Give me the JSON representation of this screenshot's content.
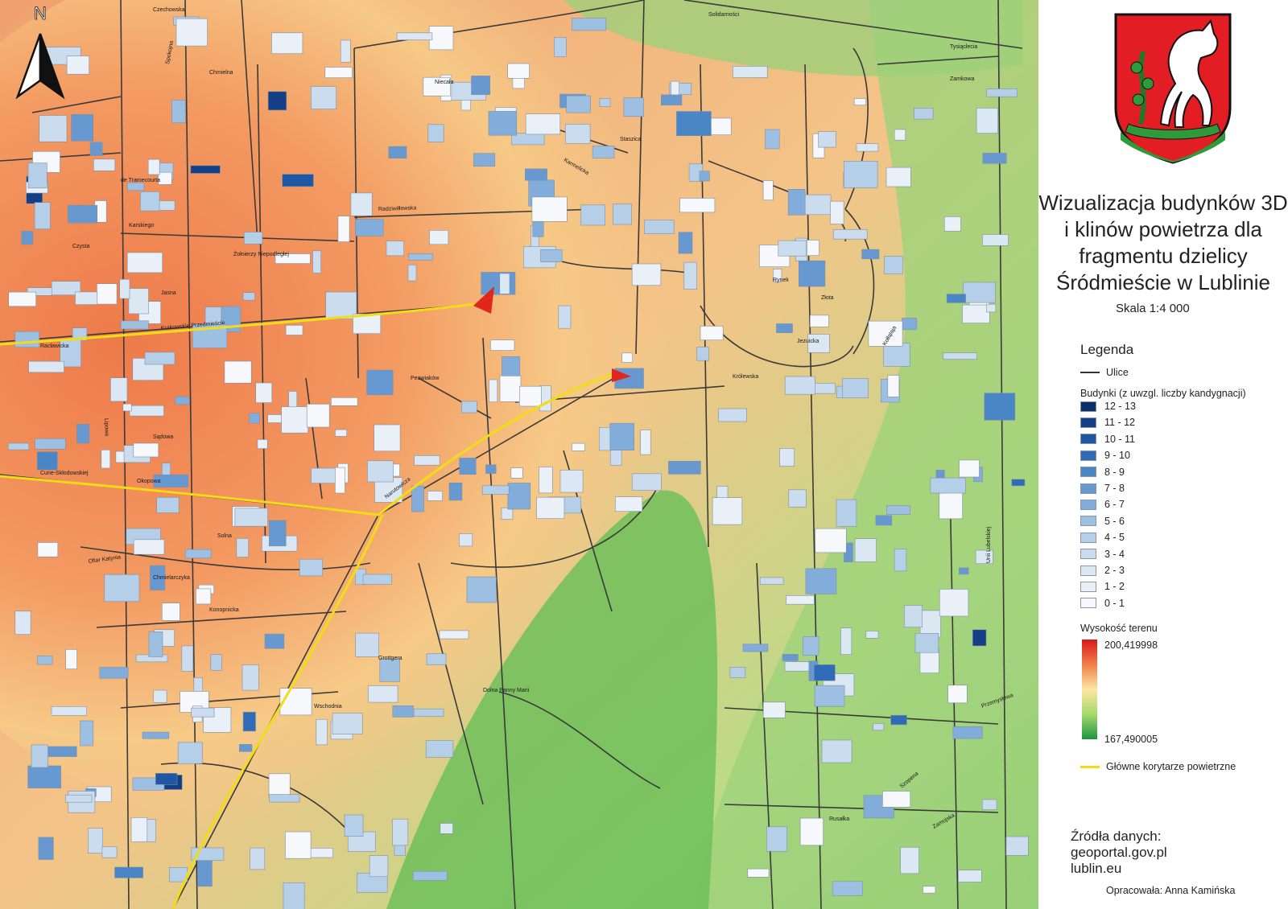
{
  "title_lines": [
    "Wizualizacja budynków 3D",
    "i klinów powietrza dla",
    "fragmentu dzielicy",
    "Śródmieście w Lublinie"
  ],
  "scale": "Skala 1:4 000",
  "north_label": "N",
  "legend": {
    "heading": "Legenda",
    "streets_label": "Ulice",
    "buildings_heading": "Budynki (z uwzgl. liczby kandygnacji)",
    "building_classes": [
      {
        "label": "12 - 13",
        "color": "#0b2f6b"
      },
      {
        "label": "11 - 12",
        "color": "#143f86"
      },
      {
        "label": "10 - 11",
        "color": "#1f57a4"
      },
      {
        "label": "9 - 10",
        "color": "#2f6cb8"
      },
      {
        "label": "8 - 9",
        "color": "#4a85c5"
      },
      {
        "label": "7 - 8",
        "color": "#6799d0"
      },
      {
        "label": "6 - 7",
        "color": "#82acd9"
      },
      {
        "label": "5 - 6",
        "color": "#9dbfe2"
      },
      {
        "label": "4 - 5",
        "color": "#b6cfe9"
      },
      {
        "label": "3 - 4",
        "color": "#cbdcef"
      },
      {
        "label": "2 - 3",
        "color": "#dce7f4"
      },
      {
        "label": "1 - 2",
        "color": "#e9f0f8"
      },
      {
        "label": "0 - 1",
        "color": "#f6f8fb"
      }
    ],
    "terrain_heading": "Wysokość terenu",
    "terrain_max": "200,419998",
    "terrain_min": "167,490005",
    "corridor_label": "Główne korytarze powietrzne"
  },
  "sources": {
    "heading": "Źródła danych:",
    "lines": [
      "geoportal.gov.pl",
      "lublin.eu"
    ]
  },
  "author": "Opracowała: Anna Kamińska",
  "colors": {
    "street": "#3a3a3a",
    "corridor": "#f2dc17",
    "arrow": "#e0261d",
    "terrain_high": "#d7191c",
    "terrain_low": "#1a9641"
  },
  "map": {
    "street_labels": [
      "Krakowskie Przedmieście",
      "Lipowa",
      "Okopowa",
      "Narutowicza",
      "Chmielna",
      "Radziwiłłowska",
      "Żołnierzy Niepodległej",
      "Peowiaków",
      "Karmelicka",
      "Staszica",
      "Królewska",
      "Rynek",
      "Złota",
      "Jezuicka",
      "Dolna Panny Marii",
      "Rusałka",
      "Zamojska",
      "Sądowa",
      "Solna",
      "Konopnicka",
      "Chmielarczyka",
      "Curie-Skłodowskiej",
      "Ofiar Katynia",
      "Wschodnia",
      "Szopena",
      "Kołłątaja",
      "Zamkowa",
      "Tysiąclecia",
      "Solidarności",
      "Czechowska",
      "Niecała",
      "Jasna",
      "Karskiego",
      "Czysta",
      "Racławicka",
      "de Tramecourta",
      "Grottgera",
      "Spokojna",
      "Przemysłowa",
      "Unii Lubelskiej"
    ]
  }
}
